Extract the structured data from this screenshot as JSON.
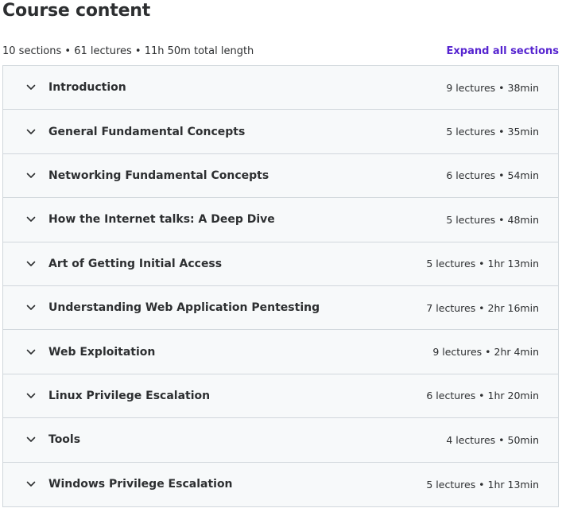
{
  "header": {
    "title": "Course content",
    "summary": "10 sections • 61 lectures • 11h 50m total length",
    "expand_label": "Expand all sections"
  },
  "colors": {
    "accent": "#5624d0",
    "border": "#d1d7dc",
    "section_bg": "#f7f9fa",
    "text": "#2d2f31"
  },
  "sections": [
    {
      "title": "Introduction",
      "info": "9 lectures • 38min",
      "icon": "chevron-down-icon"
    },
    {
      "title": "General Fundamental Concepts",
      "info": "5 lectures • 35min",
      "icon": "chevron-down-icon"
    },
    {
      "title": "Networking Fundamental Concepts",
      "info": "6 lectures • 54min",
      "icon": "chevron-down-icon"
    },
    {
      "title": "How the Internet talks: A Deep Dive",
      "info": "5 lectures • 48min",
      "icon": "chevron-down-icon"
    },
    {
      "title": "Art of Getting Initial Access",
      "info": "5 lectures • 1hr 13min",
      "icon": "chevron-down-icon"
    },
    {
      "title": "Understanding Web Application Pentesting",
      "info": "7 lectures • 2hr 16min",
      "icon": "chevron-down-icon"
    },
    {
      "title": "Web Exploitation",
      "info": "9 lectures • 2hr 4min",
      "icon": "chevron-down-icon"
    },
    {
      "title": "Linux Privilege Escalation",
      "info": "6 lectures • 1hr 20min",
      "icon": "chevron-down-icon"
    },
    {
      "title": "Tools",
      "info": "4 lectures • 50min",
      "icon": "chevron-down-icon"
    },
    {
      "title": "Windows Privilege Escalation",
      "info": "5 lectures • 1hr 13min",
      "icon": "chevron-down-icon"
    }
  ]
}
